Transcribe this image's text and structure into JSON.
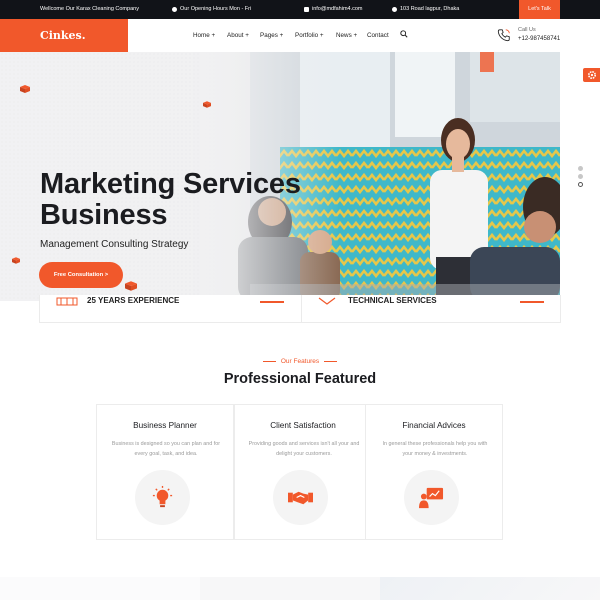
{
  "topbar": {
    "welcome": "Wellcome Our Karax Cleaning Company",
    "hours": "Our Opening Hours Mon - Fri",
    "email": "info@mdfahim4.com",
    "address": "103 Road lagpur, Dhaka",
    "cta": "Let's Talk"
  },
  "header": {
    "logo": "Cinkes.",
    "nav": [
      "Home +",
      "About +",
      "Pages +",
      "Portfolio +",
      "News +",
      "Contact"
    ],
    "call_label": "Call Us",
    "call_number": "+12-987458741"
  },
  "hero": {
    "title_line1": "Marketing Services",
    "title_line2": "Business",
    "subtitle": "Management Consulting Strategy",
    "cta": "Free Consultation >"
  },
  "stats": {
    "left": "25 YEARS EXPERIENCE",
    "right": "TECHNICAL SERVICES"
  },
  "features": {
    "eyebrow": "Our Features",
    "title": "Professional Featured",
    "cards": [
      {
        "title": "Business Planner",
        "text": "Business is designed so you can plan and for every goal, task, and idea.",
        "icon": "lightbulb-icon"
      },
      {
        "title": "Client Satisfaction",
        "text": "Providing goods and services isn't all your and delight your customers.",
        "icon": "handshake-icon"
      },
      {
        "title": "Financial Advices",
        "text": "In general these professionals help you with your money & investments.",
        "icon": "presentation-icon"
      }
    ]
  },
  "colors": {
    "accent": "#f1582b",
    "dark": "#111318"
  }
}
